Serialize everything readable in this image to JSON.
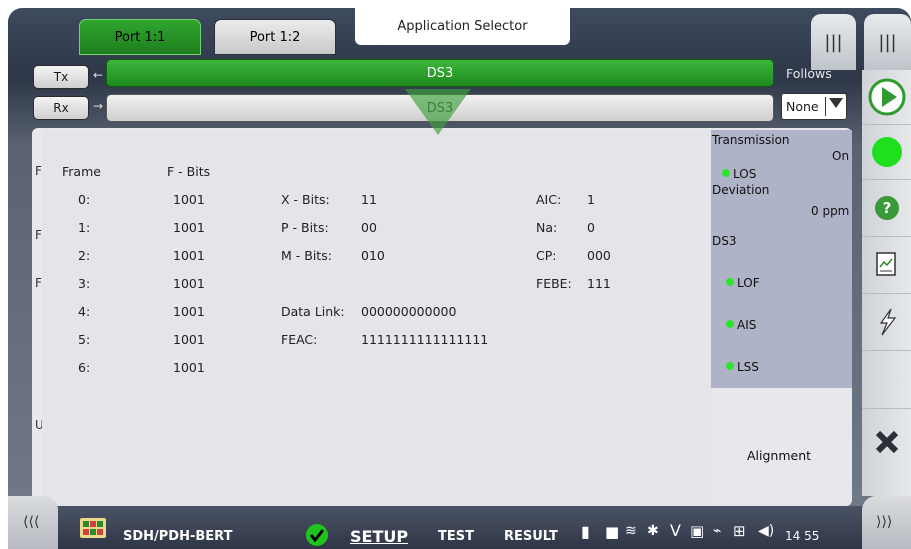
{
  "tabs": {
    "port1": "Port 1:1",
    "port2": "Port 1:2",
    "app_selector": "Application Selector"
  },
  "right_top": {
    "menu1": "|||",
    "menu2": "|||"
  },
  "tx": {
    "label": "Tx",
    "signal": "DS3"
  },
  "rx": {
    "label": "Rx",
    "signal": "DS3"
  },
  "follows": {
    "label": "Follows",
    "value": "None"
  },
  "frame_table": {
    "col_frame": "Frame",
    "col_fbits": "F - Bits",
    "rows": [
      {
        "frame": "0:",
        "fbits": "1001"
      },
      {
        "frame": "1:",
        "fbits": "1001"
      },
      {
        "frame": "2:",
        "fbits": "1001"
      },
      {
        "frame": "3:",
        "fbits": "1001"
      },
      {
        "frame": "4:",
        "fbits": "1001"
      },
      {
        "frame": "5:",
        "fbits": "1001"
      },
      {
        "frame": "6:",
        "fbits": "1001"
      }
    ]
  },
  "bits": {
    "x_label": "X - Bits:",
    "x_value": "11",
    "p_label": "P - Bits:",
    "p_value": "00",
    "m_label": "M - Bits:",
    "m_value": "010",
    "datalink_label": "Data Link:",
    "datalink_value": "000000000000",
    "feac_label": "FEAC:",
    "feac_value": "1111111111111111"
  },
  "codes": {
    "aic_label": "AIC:",
    "aic_value": "1",
    "na_label": "Na:",
    "na_value": "0",
    "cp_label": "CP:",
    "cp_value": "000",
    "febe_label": "FEBE:",
    "febe_value": "111"
  },
  "status": {
    "transmission": "Transmission",
    "transmission_value": "On",
    "los": "LOS",
    "deviation": "Deviation",
    "deviation_value": "0 ppm",
    "ds3": "DS3",
    "lof": "LOF",
    "ais": "AIS",
    "lss": "LSS"
  },
  "alignment": "Alignment",
  "edge_letters": [
    "F",
    "F",
    "F",
    "U"
  ],
  "bottom": {
    "app_name": "SDH/PDH-BERT",
    "setup": "SETUP",
    "test": "TEST",
    "result": "RESULT",
    "time": "14 55"
  },
  "colors": {
    "green": "#1e8a1e",
    "indicator": "#2ee52e",
    "panel": "#e4e4ea",
    "status_bg": "#aeb3c7"
  },
  "icons": [
    "collapse-left-icon",
    "expand-right-icon",
    "play-icon",
    "status-led-icon",
    "help-icon",
    "report-icon",
    "inject-icon",
    "close-icon",
    "check-icon",
    "battery-icon",
    "wifi-icon",
    "volume-icon"
  ]
}
